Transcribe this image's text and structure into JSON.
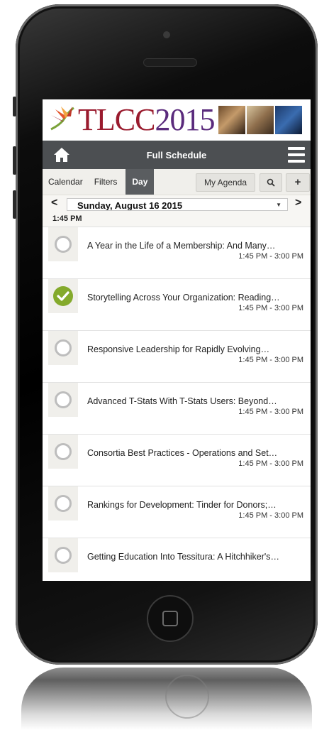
{
  "app": {
    "banner": {
      "title": "TLCC",
      "year": "2015"
    },
    "header": {
      "title": "Full Schedule"
    },
    "tabs": [
      "Calendar",
      "Filters",
      "Day"
    ],
    "buttons": {
      "my_agenda": "My Agenda",
      "search_icon": "search-icon",
      "add": "+"
    },
    "date_nav": {
      "prev": "<",
      "next": ">",
      "selected_date": "Sunday, August 16 2015"
    },
    "time_slot": "1:45 PM",
    "sessions": [
      {
        "title": "A Year in the Life of a Membership: And Many…",
        "time": "1:45 PM - 3:00 PM",
        "checked": false
      },
      {
        "title": "Storytelling Across Your Organization: Reading…",
        "time": "1:45 PM - 3:00 PM",
        "checked": true
      },
      {
        "title": "Responsive Leadership for Rapidly Evolving…",
        "time": "1:45 PM - 3:00 PM",
        "checked": false
      },
      {
        "title": "Advanced T-Stats With T-Stats Users: Beyond…",
        "time": "1:45 PM - 3:00 PM",
        "checked": false
      },
      {
        "title": "Consortia Best Practices - Operations and Set…",
        "time": "1:45 PM - 3:00 PM",
        "checked": false
      },
      {
        "title": "Rankings for Development: Tinder for Donors;…",
        "time": "1:45 PM - 3:00 PM",
        "checked": false
      },
      {
        "title": "Getting Education Into Tessitura: A Hitchhiker's…",
        "time": "",
        "checked": false
      }
    ],
    "colors": {
      "brand_red": "#9a1b2e",
      "header_bg": "#4c4f52",
      "check_green": "#84aa2c"
    }
  }
}
